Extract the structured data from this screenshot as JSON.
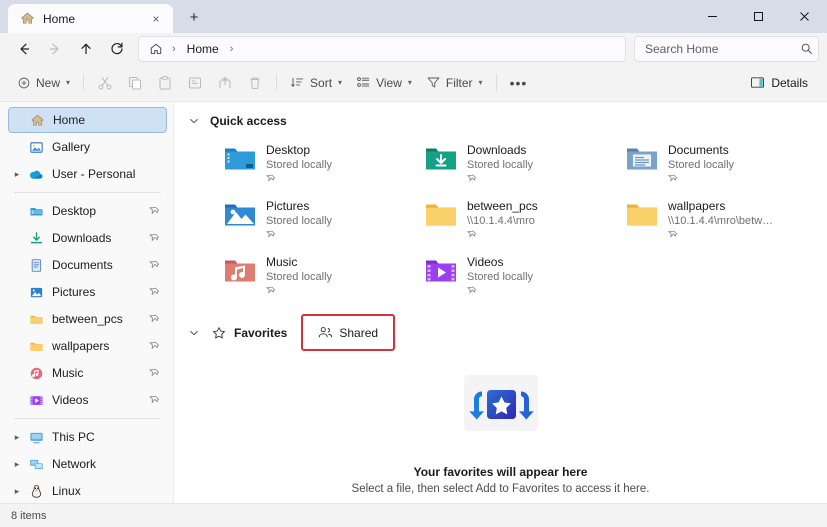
{
  "window": {
    "tab": {
      "icon": "home-icon",
      "label": "Home",
      "close_label": "×"
    },
    "newtab_label": "+",
    "caption": {
      "minimize": "─",
      "maximize": "□",
      "close": "✕"
    }
  },
  "nav": {
    "back": "back-arrow-icon",
    "forward": "forward-arrow-icon",
    "up": "up-arrow-icon",
    "refresh": "refresh-icon",
    "breadcrumb": {
      "home_icon": "home-outline-icon",
      "sep1": "›",
      "label": "Home",
      "sep2": "›"
    },
    "search": {
      "placeholder": "Search Home",
      "icon": "search-icon"
    }
  },
  "toolbar": {
    "new_label": "New",
    "cut_label": "cut-icon",
    "copy_label": "copy-icon",
    "paste_label": "paste-icon",
    "rename_label": "rename-icon",
    "share_label": "share-icon",
    "delete_label": "delete-icon",
    "sort_label": "Sort",
    "view_label": "View",
    "filter_label": "Filter",
    "more_label": "•••",
    "details_label": "Details"
  },
  "sidebar": {
    "groups": [
      {
        "items": [
          {
            "label": "Home",
            "icon": "home-icon",
            "selected": true,
            "expander": false,
            "pin": false
          },
          {
            "label": "Gallery",
            "icon": "gallery-icon",
            "selected": false,
            "expander": false,
            "pin": false
          },
          {
            "label": "User - Personal",
            "icon": "onedrive-icon",
            "selected": false,
            "expander": true,
            "pin": false
          }
        ]
      },
      {
        "items": [
          {
            "label": "Desktop",
            "icon": "desktop-folder-icon",
            "selected": false,
            "expander": false,
            "pin": true
          },
          {
            "label": "Downloads",
            "icon": "downloads-icon",
            "selected": false,
            "expander": false,
            "pin": true
          },
          {
            "label": "Documents",
            "icon": "documents-icon",
            "selected": false,
            "expander": false,
            "pin": true
          },
          {
            "label": "Pictures",
            "icon": "pictures-folder-icon",
            "selected": false,
            "expander": false,
            "pin": true
          },
          {
            "label": "between_pcs",
            "icon": "folder-icon",
            "selected": false,
            "expander": false,
            "pin": true
          },
          {
            "label": "wallpapers",
            "icon": "folder-icon",
            "selected": false,
            "expander": false,
            "pin": true
          },
          {
            "label": "Music",
            "icon": "music-icon",
            "selected": false,
            "expander": false,
            "pin": true
          },
          {
            "label": "Videos",
            "icon": "videos-icon",
            "selected": false,
            "expander": false,
            "pin": true
          }
        ]
      },
      {
        "items": [
          {
            "label": "This PC",
            "icon": "this-pc-icon",
            "selected": false,
            "expander": true,
            "pin": false
          },
          {
            "label": "Network",
            "icon": "network-icon",
            "selected": false,
            "expander": true,
            "pin": false
          },
          {
            "label": "Linux",
            "icon": "linux-penguin-icon",
            "selected": false,
            "expander": true,
            "pin": false
          }
        ]
      }
    ]
  },
  "quick_access": {
    "chevron": "⌄",
    "title": "Quick access",
    "items": [
      {
        "name": "Desktop",
        "sub": "Stored locally",
        "icon": "desktop-folder-icon",
        "pinned": true
      },
      {
        "name": "Downloads",
        "sub": "Stored locally",
        "icon": "downloads-folder-icon",
        "pinned": true
      },
      {
        "name": "Documents",
        "sub": "Stored locally",
        "icon": "documents-folder-icon",
        "pinned": true
      },
      {
        "name": "Pictures",
        "sub": "Stored locally",
        "icon": "pictures-folder-icon",
        "pinned": true
      },
      {
        "name": "between_pcs",
        "sub": "\\\\10.1.4.4\\mro",
        "icon": "folder-icon",
        "pinned": true
      },
      {
        "name": "wallpapers",
        "sub": "\\\\10.1.4.4\\mro\\betw…",
        "icon": "folder-icon",
        "pinned": true
      },
      {
        "name": "Music",
        "sub": "Stored locally",
        "icon": "music-folder-icon",
        "pinned": true
      },
      {
        "name": "Videos",
        "sub": "Stored locally",
        "icon": "videos-folder-icon",
        "pinned": true
      }
    ]
  },
  "favorites": {
    "chevron": "⌄",
    "star_icon": "star-outline-icon",
    "title": "Favorites",
    "shared_button": {
      "icon": "people-icon",
      "label": "Shared",
      "highlighted": true,
      "highlight_color": "#d13438"
    },
    "empty_title": "Your favorites will appear here",
    "empty_subtitle": "Select a file, then select Add to Favorites to access it here.",
    "empty_art": "favorites-star-illustration"
  },
  "statusbar": {
    "item_count": "8 items"
  },
  "colors": {
    "titlebar": "#d6dce8",
    "tab_active": "#fbfbfd",
    "chrome": "#f3f3f3",
    "sidebar": "#f9f9f9",
    "selection": "#cfe2f5",
    "highlight": "#d13438",
    "accent_blue": "#2954c8"
  }
}
